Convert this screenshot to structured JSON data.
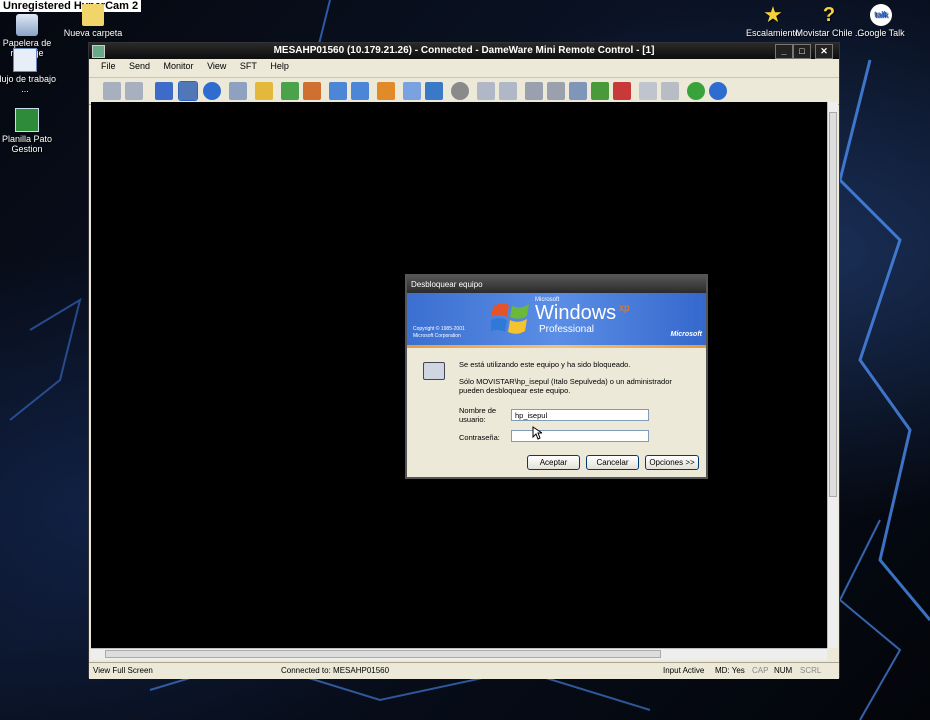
{
  "watermark": "Unregistered HyperCam 2",
  "desktop_icons": {
    "recycle": "Papelera de reciclaje",
    "folder": "Nueva carpeta",
    "flujo": "Flujo de trabajo ...",
    "planilla": "Planilla Pato Gestion",
    "escalamiento": "Escalamiento",
    "movistar": "Movistar Chile ...",
    "gtalk": "Google Talk"
  },
  "window": {
    "title": "MESAHP01560 (10.179.21.26) - Connected - DameWare Mini Remote Control - [1]",
    "menu": [
      "File",
      "Send",
      "Monitor",
      "View",
      "SFT",
      "Help"
    ]
  },
  "status": {
    "left": "View Full Screen",
    "connected": "Connected to: MESAHP01560",
    "input": "Input Active",
    "md": "MD: Yes",
    "cap": "CAP",
    "num": "NUM",
    "scrl": "SCRL"
  },
  "dialog": {
    "title": "Desbloquear equipo",
    "brand_ms": "Microsoft",
    "brand_windows": "Windows",
    "brand_xp": "xp",
    "brand_pro": "Professional",
    "copyright_1": "Copyright © 1985-2001",
    "copyright_2": "Microsoft Corporation",
    "ms_logo": "Microsoft",
    "msg1": "Se está utilizando este equipo y ha sido bloqueado.",
    "msg2a": "Sólo MOVISTAR\\hp_isepul (Italo Sepulveda) o un administrador",
    "msg2b": "pueden desbloquear este equipo.",
    "user_label_1": "Nombre de",
    "user_label_2": "usuario:",
    "user_value": "hp_isepul",
    "pass_label": "Contraseña:",
    "pass_value": "",
    "btn_ok": "Aceptar",
    "btn_cancel": "Cancelar",
    "btn_options": "Opciones >>"
  }
}
